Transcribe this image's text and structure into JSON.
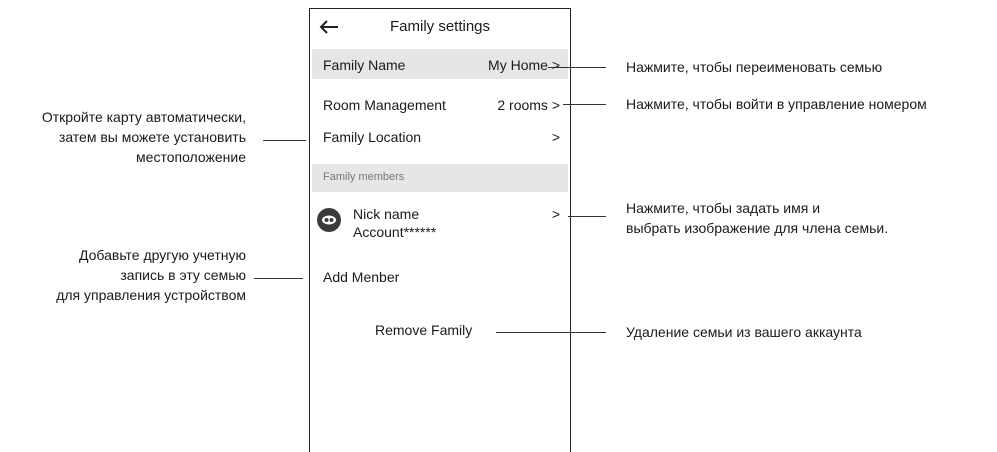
{
  "header": {
    "title": "Family settings",
    "back_icon": "arrow-left-icon"
  },
  "family_name": {
    "label": "Family Name",
    "value": "My Home >"
  },
  "room_management": {
    "label": "Room Management",
    "value": "2 rooms >"
  },
  "family_location": {
    "label": "Family Location",
    "value": ">"
  },
  "members_section": {
    "label": "Family members"
  },
  "member": {
    "name": "Nick name",
    "account": "Account******",
    "chevron": ">",
    "avatar_icon": "member-avatar-icon"
  },
  "add_member": {
    "label": "Add Menber"
  },
  "remove_family": {
    "label": "Remove Family"
  },
  "annotations": {
    "rename_family": "Нажмите, чтобы переименовать семью",
    "room_management": "Нажмите, чтобы войти в управление номером",
    "location_lines": [
      "Откройте карту автоматически,",
      "затем вы можете установить",
      "местоположение"
    ],
    "member_lines": [
      "Нажмите, чтобы задать имя и",
      "выбрать изображение для члена семьи."
    ],
    "add_member_lines": [
      "Добавьте другую учетную",
      "запись в эту семью",
      "для управления устройством"
    ],
    "remove_family": "Удаление семьи из вашего аккаунта"
  }
}
